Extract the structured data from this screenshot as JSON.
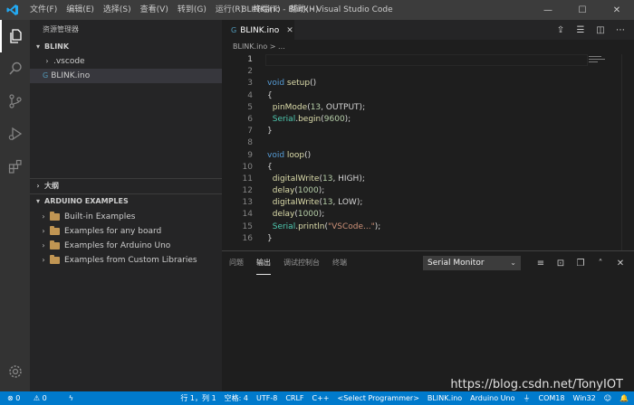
{
  "titlebar": {
    "menu": [
      "文件(F)",
      "编辑(E)",
      "选择(S)",
      "查看(V)",
      "转到(G)",
      "运行(R)",
      "终端(T)",
      "帮助(H)"
    ],
    "title": "BLINK.ino - Blink - Visual Studio Code",
    "controls": [
      "—",
      "☐",
      "✕"
    ]
  },
  "sidebar": {
    "title": "资源管理器",
    "workspace": "BLINK",
    "tree": [
      ".vscode",
      "BLINK.ino"
    ],
    "outline": "大纲",
    "examples_header": "ARDUINO EXAMPLES",
    "examples": [
      "Built-in Examples",
      "Examples for any board",
      "Examples for Arduino Uno",
      "Examples from Custom Libraries"
    ]
  },
  "editor": {
    "tab_label": "BLINK.ino",
    "breadcrumb": "BLINK.ino > ...",
    "line_numbers": [
      "1",
      "2",
      "3",
      "4",
      "5",
      "6",
      "7",
      "8",
      "9",
      "10",
      "11",
      "12",
      "13",
      "14",
      "15",
      "16"
    ]
  },
  "panel": {
    "tabs": [
      "问题",
      "输出",
      "调试控制台",
      "终端"
    ],
    "active_tab": "输出",
    "select_value": "Serial Monitor"
  },
  "statusbar": {
    "errors": "0",
    "warnings": "0",
    "position": "行 1，列 1",
    "spaces": "空格: 4",
    "encoding": "UTF-8",
    "eol": "CRLF",
    "language": "C++",
    "programmer": "<Select Programmer>",
    "file": "BLINK.ino",
    "board": "Arduino Uno",
    "port": "COM18",
    "platform": "Win32"
  },
  "watermark": "https://blog.csdn.net/TonyIOT",
  "colors": {
    "accent": "#007acc",
    "keyword": "#569cd6",
    "function": "#dcdcaa",
    "number": "#b5cea8",
    "string": "#ce9178",
    "class": "#4ec9b0"
  }
}
